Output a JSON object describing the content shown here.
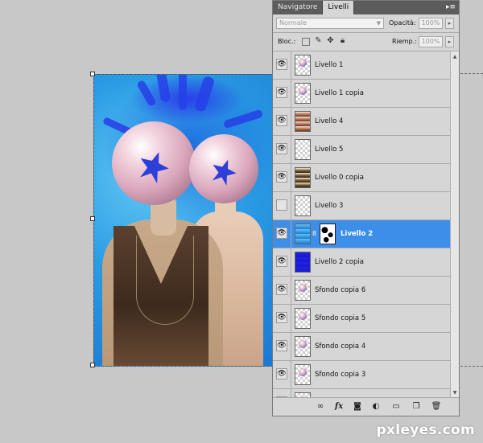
{
  "panel": {
    "tabs": [
      {
        "label": "Navigatore",
        "active": false
      },
      {
        "label": "Livelli",
        "active": true
      }
    ],
    "blend_mode": "Normale",
    "opacity_label": "Opacità:",
    "opacity_value": "100%",
    "lock_label": "Bloc.:",
    "fill_label": "Riemp.:",
    "fill_value": "100%",
    "layers": [
      {
        "name": "Livello 1",
        "visible": true,
        "selected": false,
        "thumb": "sphere-small",
        "has_mask": false
      },
      {
        "name": "Livello 1 copia",
        "visible": true,
        "selected": false,
        "thumb": "sphere-small",
        "has_mask": false
      },
      {
        "name": "Livello 4",
        "visible": true,
        "selected": false,
        "thumb": "photo-brown",
        "has_mask": false
      },
      {
        "name": "Livello 5",
        "visible": true,
        "selected": false,
        "thumb": "transparent",
        "has_mask": false
      },
      {
        "name": "Livello 0 copia",
        "visible": true,
        "selected": false,
        "thumb": "photo-dark",
        "has_mask": false
      },
      {
        "name": "Livello 3",
        "visible": false,
        "selected": false,
        "thumb": "transparent",
        "has_mask": false
      },
      {
        "name": "Livello 2",
        "visible": true,
        "selected": true,
        "thumb": "blue-fill",
        "has_mask": true
      },
      {
        "name": "Livello 2 copia",
        "visible": true,
        "selected": false,
        "thumb": "blue-solid",
        "has_mask": false
      },
      {
        "name": "Sfondo copia 6",
        "visible": true,
        "selected": false,
        "thumb": "sphere-small",
        "has_mask": false
      },
      {
        "name": "Sfondo copia 5",
        "visible": true,
        "selected": false,
        "thumb": "sphere-small",
        "has_mask": false
      },
      {
        "name": "Sfondo copia 4",
        "visible": true,
        "selected": false,
        "thumb": "sphere-small",
        "has_mask": false
      },
      {
        "name": "Sfondo copia 3",
        "visible": true,
        "selected": false,
        "thumb": "sphere-small",
        "has_mask": false
      },
      {
        "name": "",
        "visible": true,
        "selected": false,
        "thumb": "sphere-small",
        "has_mask": false
      }
    ],
    "bottom_icons": [
      "link-icon",
      "fx-icon",
      "mask-icon",
      "adjustment-icon",
      "folder-icon",
      "new-layer-icon",
      "trash-icon"
    ],
    "fx_label": "fx"
  },
  "watermark": "pxleyes.com",
  "colors": {
    "selection": "#3d8ee8",
    "panel_bg": "#d6d6d6",
    "tab_bar": "#5c5c5c"
  }
}
